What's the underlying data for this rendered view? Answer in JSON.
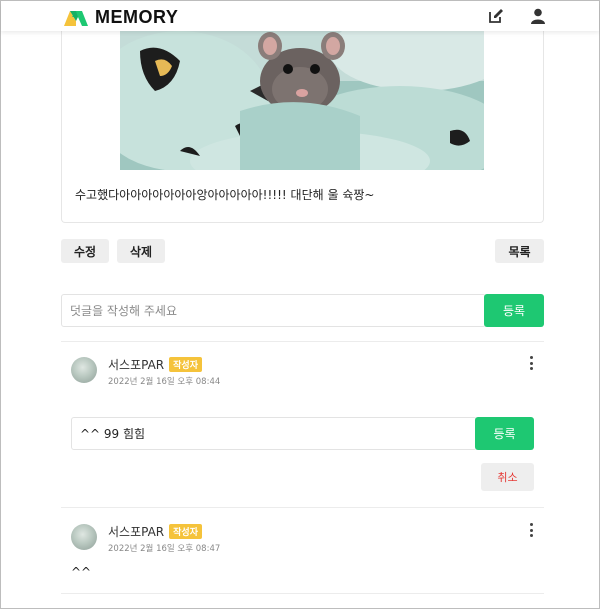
{
  "header": {
    "brand": "MEMORY",
    "icons": [
      "edit-icon",
      "user-icon"
    ],
    "brand_colors": [
      "#f5c33b",
      "#1ec872"
    ]
  },
  "post": {
    "image_alt": "hamster under a blanket",
    "text": "수고했다아아아아아아아앙아아아아아!!!!! 대단해 울 슉짱~",
    "edit_label": "수정",
    "delete_label": "삭제",
    "list_label": "목록"
  },
  "comment_form": {
    "placeholder": "덧글을 작성해 주세요",
    "submit_label": "등록"
  },
  "comments": [
    {
      "author": "서스포PAR",
      "badge": "작성자",
      "date": "2022년 2월 16일 오후 08:44",
      "edit_value": "^^ 99 힘힘",
      "submit_label": "등록",
      "cancel_label": "취소"
    },
    {
      "author": "서스포PAR",
      "badge": "작성자",
      "date": "2022년 2월 16일 오후 08:47",
      "text": "^^"
    }
  ],
  "colors": {
    "accent_green": "#1ec872",
    "badge_yellow": "#f5c33b",
    "cancel_red": "#e53935"
  }
}
